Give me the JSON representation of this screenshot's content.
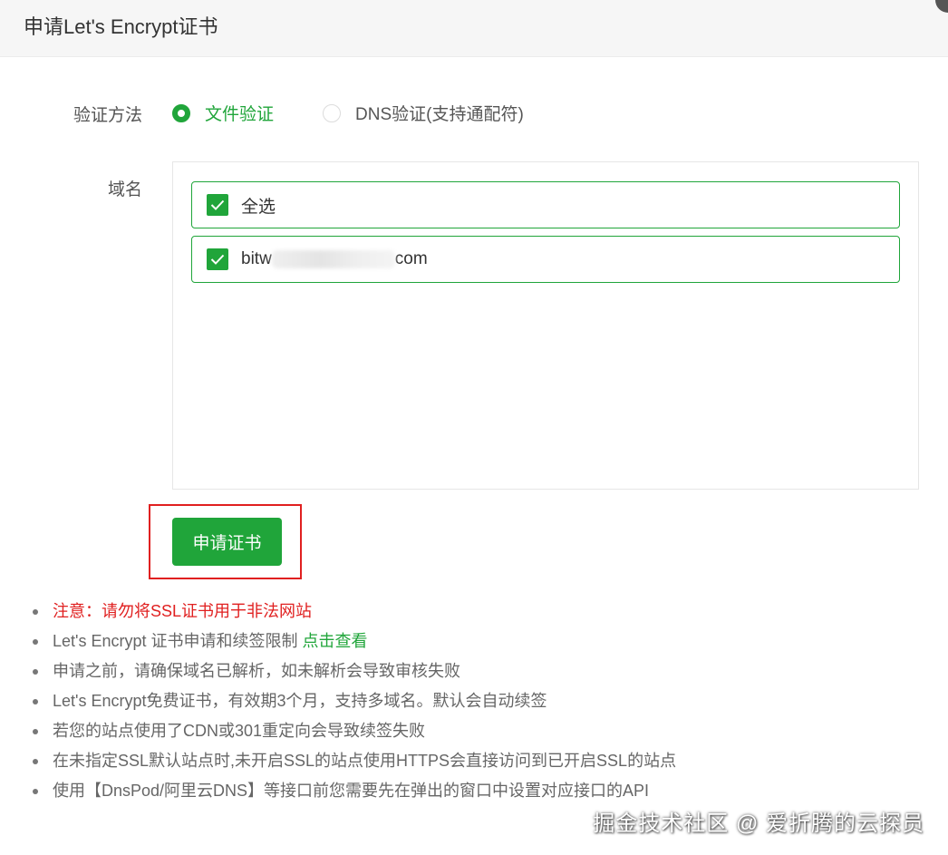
{
  "dialog": {
    "title": "申请Let's Encrypt证书"
  },
  "verify": {
    "label": "验证方法",
    "options": [
      {
        "label": "文件验证",
        "selected": true
      },
      {
        "label": "DNS验证(支持通配符)",
        "selected": false
      }
    ]
  },
  "domain": {
    "label": "域名",
    "select_all": {
      "label": "全选",
      "checked": true
    },
    "items": [
      {
        "prefix": "bitw",
        "suffix": "com",
        "checked": true
      }
    ]
  },
  "apply_button": "申请证书",
  "notes": {
    "warning": "注意：请勿将SSL证书用于非法网站",
    "limit_text": "Let's Encrypt 证书申请和续签限制 ",
    "limit_link": "点击查看",
    "n3": "申请之前，请确保域名已解析，如未解析会导致审核失败",
    "n4": "Let's Encrypt免费证书，有效期3个月，支持多域名。默认会自动续签",
    "n5": "若您的站点使用了CDN或301重定向会导致续签失败",
    "n6": "在未指定SSL默认站点时,未开启SSL的站点使用HTTPS会直接访问到已开启SSL的站点",
    "n7": "使用【DnsPod/阿里云DNS】等接口前您需要先在弹出的窗口中设置对应接口的API"
  },
  "watermark": "掘金技术社区 @ 爱折腾的云探员",
  "colors": {
    "accent": "#20a53a",
    "warning": "#e02020",
    "highlight_border": "#e02020"
  }
}
